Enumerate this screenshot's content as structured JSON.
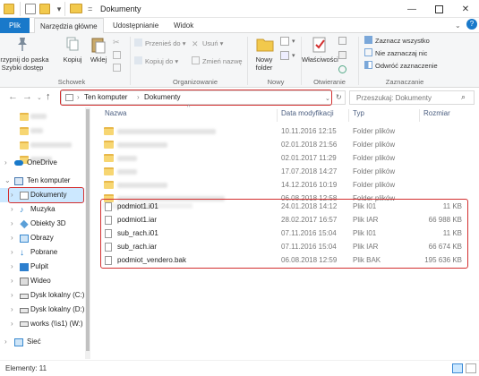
{
  "window": {
    "title": "Dokumenty"
  },
  "tabs": [
    {
      "label": "Plik"
    },
    {
      "label": "Narzędzia główne"
    },
    {
      "label": "Udostępnianie"
    },
    {
      "label": "Widok"
    }
  ],
  "ribbon": {
    "pin_label": "Przypnij do paska Szybki dostęp",
    "copy_label": "Kopiuj",
    "paste_label": "Wklej",
    "move_to_label": "Przenieś do",
    "copy_to_label": "Kopiuj do",
    "delete_label": "Usuń",
    "rename_label": "Zmień nazwę",
    "new_folder_label": "Nowy folder",
    "properties_label": "Właściwości",
    "select_all_label": "Zaznacz wszystko",
    "select_none_label": "Nie zaznaczaj nic",
    "invert_selection_label": "Odwróć zaznaczenie",
    "groups": {
      "clipboard": "Schowek",
      "organize": "Organizowanie",
      "new": "Nowy",
      "open": "Otwieranie",
      "select": "Zaznaczanie"
    }
  },
  "address": {
    "crumbs": [
      "Ten komputer",
      "Dokumenty"
    ],
    "search_placeholder": "Przeszukaj: Dokumenty"
  },
  "nav": {
    "items": [
      {
        "label": "OneDrive",
        "icon": "cloud-icon"
      },
      {
        "label": "Ten komputer",
        "icon": "computer-icon"
      },
      {
        "label": "Dokumenty",
        "icon": "documents-icon"
      },
      {
        "label": "Muzyka",
        "icon": "music-icon"
      },
      {
        "label": "Obiekty 3D",
        "icon": "cube-icon"
      },
      {
        "label": "Obrazy",
        "icon": "pictures-icon"
      },
      {
        "label": "Pobrane",
        "icon": "download-icon"
      },
      {
        "label": "Pulpit",
        "icon": "desktop-icon"
      },
      {
        "label": "Wideo",
        "icon": "video-icon"
      },
      {
        "label": "Dysk lokalny (C:)",
        "icon": "drive-icon"
      },
      {
        "label": "Dysk lokalny (D:)",
        "icon": "drive-icon"
      },
      {
        "label": "works (\\\\s1) (W:)",
        "icon": "network-drive-icon"
      },
      {
        "label": "Sieć",
        "icon": "network-icon"
      }
    ]
  },
  "columns": {
    "name": "Nazwa",
    "date": "Data modyfikacji",
    "type": "Typ",
    "size": "Rozmiar"
  },
  "folders": [
    {
      "date": "10.11.2016 12:15",
      "type": "Folder plików"
    },
    {
      "date": "02.01.2018 21:56",
      "type": "Folder plików"
    },
    {
      "date": "02.01.2017 11:29",
      "type": "Folder plików"
    },
    {
      "date": "17.07.2018 14:27",
      "type": "Folder plików"
    },
    {
      "date": "14.12.2016 10:19",
      "type": "Folder plików"
    },
    {
      "date": "06.08.2018 12:58",
      "type": "Folder plików"
    }
  ],
  "files": [
    {
      "name": "podmiot1.i01",
      "date": "24.01.2018 14:12",
      "type": "Plik I01",
      "size": "11 KB"
    },
    {
      "name": "podmiot1.iar",
      "date": "28.02.2017 16:57",
      "type": "Plik IAR",
      "size": "66 988 KB"
    },
    {
      "name": "sub_rach.i01",
      "date": "07.11.2016 15:04",
      "type": "Plik I01",
      "size": "11 KB"
    },
    {
      "name": "sub_rach.iar",
      "date": "07.11.2016 15:04",
      "type": "Plik IAR",
      "size": "66 674 KB"
    },
    {
      "name": "podmiot_vendero.bak",
      "date": "06.08.2018 12:59",
      "type": "Plik BAK",
      "size": "195 636 KB"
    }
  ],
  "status": {
    "items_label": "Elementy: 11"
  }
}
